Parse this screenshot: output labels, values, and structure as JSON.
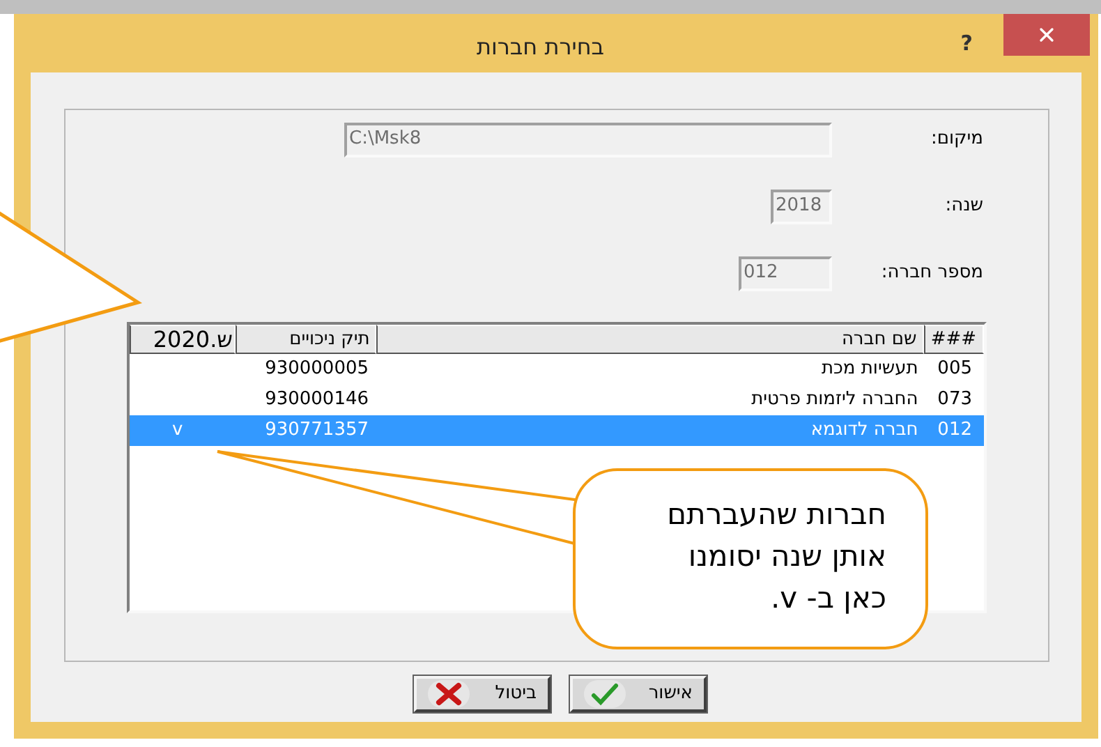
{
  "window": {
    "title": "בחירת חברות",
    "help": "?"
  },
  "fields": [
    {
      "label": "מיקום:",
      "value": "C:\\Msk8"
    },
    {
      "label": "שנה:",
      "value": "2018"
    },
    {
      "label": "מספר חברה:",
      "value": "012"
    }
  ],
  "table": {
    "columns": [
      "###",
      "שם חברה",
      "תיק ניכויים",
      "2020.ש"
    ],
    "rows": [
      {
        "code": "005",
        "name": "תעשיות מכת",
        "file": "930000005",
        "selected": false
      },
      {
        "code": "073",
        "name": "החברה ליזמות פרטית",
        "file": "930000146",
        "selected": false
      },
      {
        "code": "012",
        "name": "חברה לדוגמא",
        "file": "930771357",
        "mark": "v",
        "selected": true
      }
    ]
  },
  "buttons": [
    {
      "label": "אישור",
      "kind": "ok"
    },
    {
      "label": "ביטול",
      "kind": "cancel"
    }
  ],
  "callout": {
    "lines": [
      "חברות שהעברתם",
      "אותן שנה יסומנו",
      "כאן ב- v."
    ]
  }
}
